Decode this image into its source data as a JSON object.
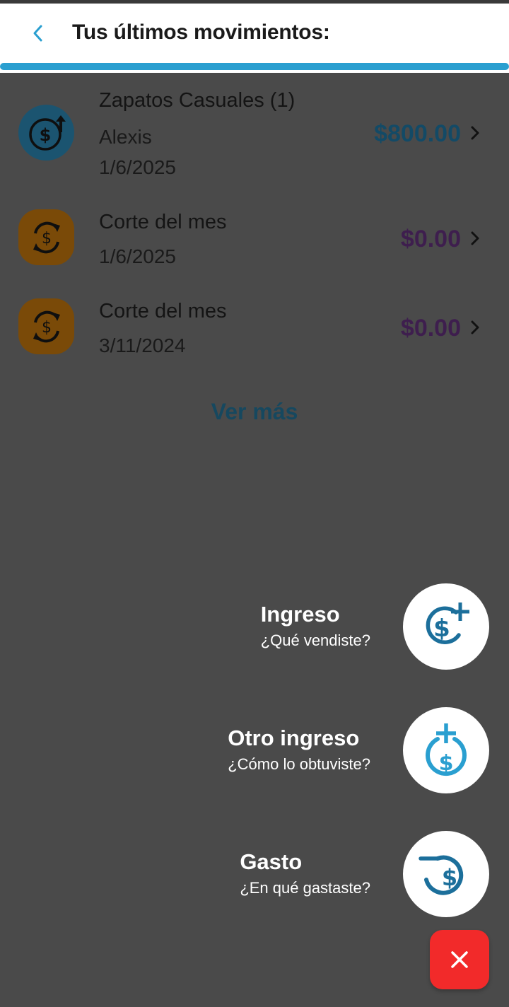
{
  "header": {
    "title": "Tus últimos movimientos:"
  },
  "transactions": [
    {
      "icon": "income-dollar-icon",
      "title": "Zapatos Casuales (1)",
      "person": "Alexis",
      "date": "1/6/2025",
      "amount": "$800.00"
    },
    {
      "icon": "cycle-dollar-icon",
      "title": "Corte del mes",
      "date": "1/6/2025",
      "amount": "$0.00"
    },
    {
      "icon": "cycle-dollar-icon",
      "title": "Corte del mes",
      "date": "3/11/2024",
      "amount": "$0.00"
    }
  ],
  "see_more": "Ver más",
  "fab_menu": [
    {
      "label": "Ingreso",
      "description": "¿Qué vendiste?",
      "icon": "dollar-plus-icon"
    },
    {
      "label": "Otro ingreso",
      "description": "¿Cómo lo obtuviste?",
      "icon": "dollar-up-plus-icon"
    },
    {
      "label": "Gasto",
      "description": "¿En qué gastaste?",
      "icon": "dollar-minus-icon"
    }
  ],
  "colors": {
    "accent": "#2a9fd0",
    "close_button": "#f22a2a",
    "overlay": "#4a4a4a"
  }
}
